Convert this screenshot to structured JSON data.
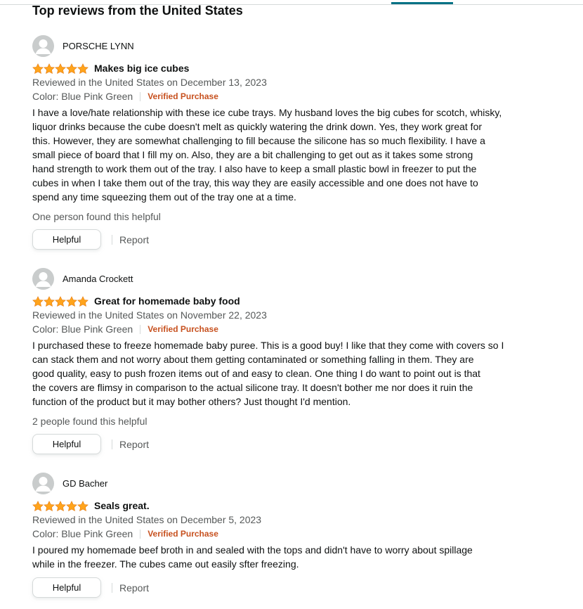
{
  "section_title": "Top reviews from the United States",
  "colors": {
    "star": "#ffa41c",
    "verified": "#c7511f",
    "link_muted": "#565959",
    "tab_indicator": "#007185"
  },
  "reviews": [
    {
      "author": "PORSCHE LYNN",
      "rating": 5,
      "title": "Makes big ice cubes",
      "date_line": "Reviewed in the United States on December 13, 2023",
      "variant": "Color: Blue Pink Green",
      "verified": "Verified Purchase",
      "body_lines": [
        "I have a love/hate relationship with these ice cube trays. My husband loves the big cubes for scotch, whisky,",
        "liquor drinks because the cube doesn't melt as quickly watering the drink down. Yes, they work great for",
        "this. However, they are somewhat challenging to fill because the silicone has so much flexibility. I have a",
        "small piece of board that I fill my on. Also, they are a bit challenging to get out as it takes some strong",
        "hand strength to work them out of the tray. I also have to keep a small plastic bowl in freezer to put the",
        "cubes in when I take them out of the tray, this way they are easily accessible and one does not have to",
        "spend any time squeezing them out of the tray one at a time."
      ],
      "helpful_count": "One person found this helpful",
      "helpful_label": "Helpful",
      "report_label": "Report"
    },
    {
      "author": "Amanda Crockett",
      "rating": 5,
      "title": "Great for homemade baby food",
      "date_line": "Reviewed in the United States on November 22, 2023",
      "variant": "Color: Blue Pink Green",
      "verified": "Verified Purchase",
      "body_lines": [
        "I purchased these to freeze homemade baby puree. This is a good buy! I like that they come with covers so I",
        "can stack them and not worry about them getting contaminated or something falling in them. They are",
        "good quality, easy to push frozen items out of and easy to clean. One thing I do want to point out is that",
        "the covers are flimsy in comparison to the actual silicone tray. It doesn't bother me nor does it ruin the",
        "function of the product but it may bother others? Just thought I'd mention."
      ],
      "helpful_count": "2 people found this helpful",
      "helpful_label": "Helpful",
      "report_label": "Report"
    },
    {
      "author": "GD Bacher",
      "rating": 5,
      "title": "Seals great.",
      "date_line": "Reviewed in the United States on December 5, 2023",
      "variant": "Color: Blue Pink Green",
      "verified": "Verified Purchase",
      "body_lines": [
        "I poured my homemade beef broth in and sealed with the tops and didn't have to worry about spillage",
        "while in the freezer. The cubes came out easily sfter freezing."
      ],
      "helpful_label": "Helpful",
      "report_label": "Report"
    }
  ]
}
